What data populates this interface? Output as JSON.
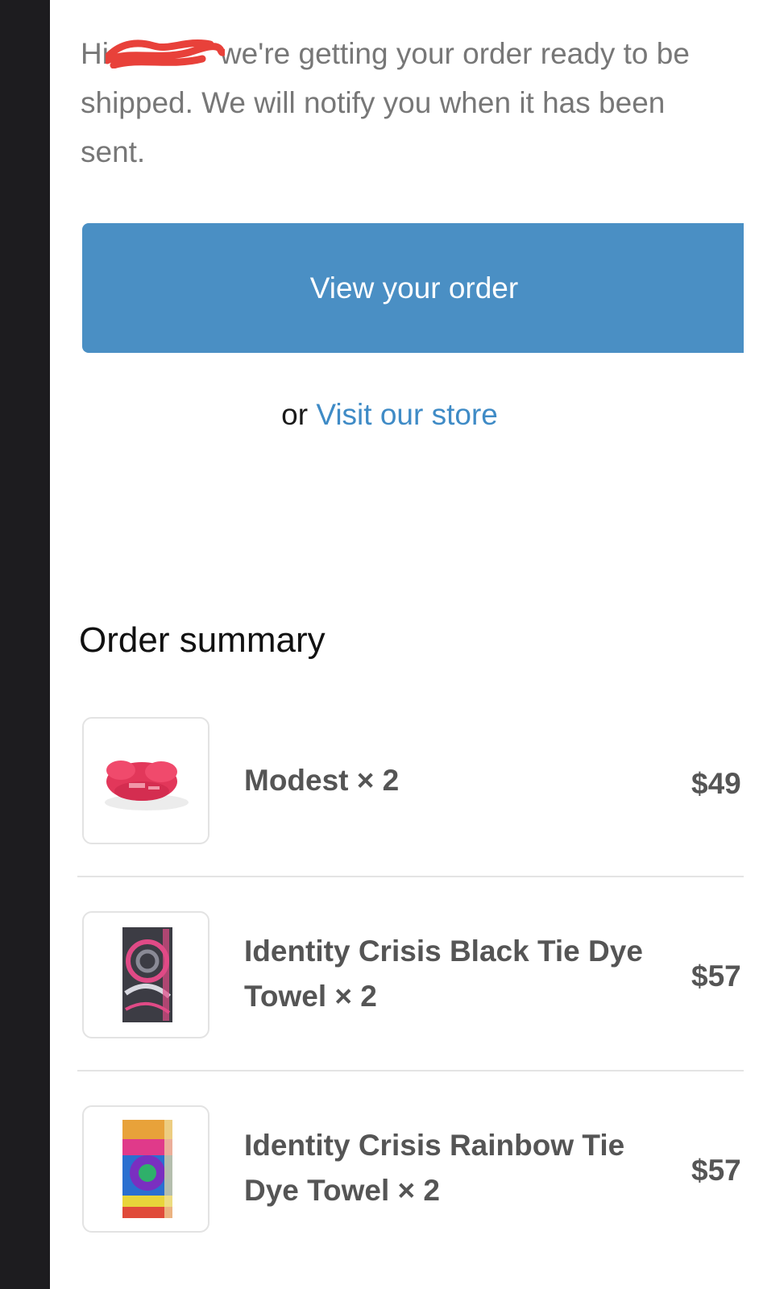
{
  "email": {
    "greeting": {
      "prefix": "Hi",
      "line1_rest": "we're getting your order ready to be",
      "line2": "shipped. We will notify you when it has been",
      "line3": "sent."
    },
    "cta_label": "View your order",
    "alt_link": {
      "prefix": "or",
      "label": "Visit our store"
    },
    "order_summary": {
      "title": "Order summary",
      "items": [
        {
          "name": "Modest × 2",
          "price": "$49",
          "image": "pink-inflatable-chair"
        },
        {
          "name": "Identity Crisis Black Tie Dye Towel × 2",
          "price": "$57",
          "image": "black-tie-dye-towel"
        },
        {
          "name": "Identity Crisis Rainbow Tie Dye Towel × 2",
          "price": "$57",
          "image": "rainbow-tie-dye-towel"
        }
      ]
    }
  },
  "colors": {
    "button": "#4a8fc4",
    "link": "#3f8bc6",
    "body_text": "#777777",
    "item_text": "#555555",
    "frame": "#1d1c1f",
    "redaction": "#e8413a"
  }
}
